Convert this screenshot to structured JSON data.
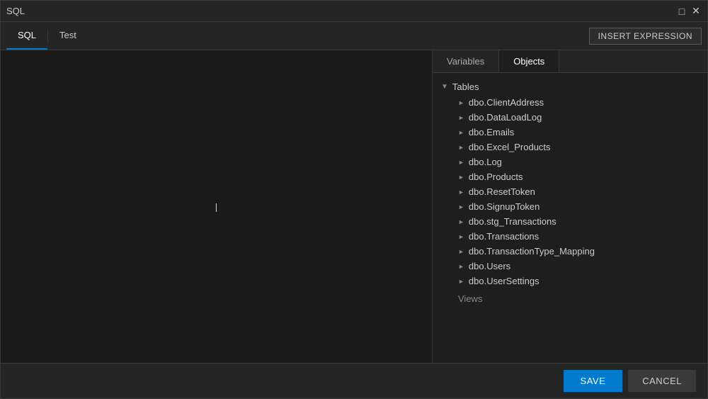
{
  "window": {
    "title": "SQL"
  },
  "toolbar": {
    "tabs": [
      {
        "id": "sql",
        "label": "SQL",
        "active": true
      },
      {
        "id": "test",
        "label": "Test",
        "active": false
      }
    ],
    "insert_expression_label": "INSERT EXPRESSION"
  },
  "right_panel": {
    "tabs": [
      {
        "id": "variables",
        "label": "Variables",
        "active": false
      },
      {
        "id": "objects",
        "label": "Objects",
        "active": true
      }
    ],
    "tree": {
      "sections": [
        {
          "id": "tables",
          "label": "Tables",
          "expanded": true,
          "items": [
            "dbo.ClientAddress",
            "dbo.DataLoadLog",
            "dbo.Emails",
            "dbo.Excel_Products",
            "dbo.Log",
            "dbo.Products",
            "dbo.ResetToken",
            "dbo.SignupToken",
            "dbo.stg_Transactions",
            "dbo.Transactions",
            "dbo.TransactionType_Mapping",
            "dbo.Users",
            "dbo.UserSettings"
          ]
        }
      ],
      "views_label": "Views"
    }
  },
  "footer": {
    "save_label": "SAVE",
    "cancel_label": "CANCEL"
  },
  "colors": {
    "accent": "#007acc",
    "bg_dark": "#1a1a1a",
    "bg_panel": "#1e1e1e",
    "bg_toolbar": "#252526",
    "text_primary": "#cccccc",
    "text_white": "#ffffff"
  }
}
